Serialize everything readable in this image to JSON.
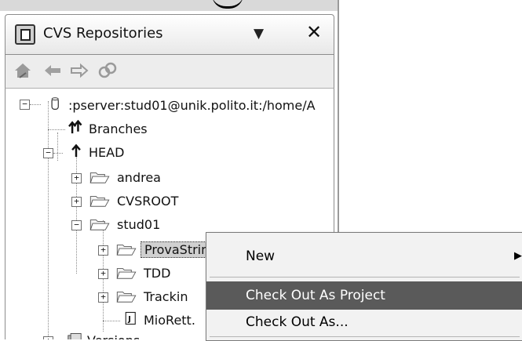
{
  "view": {
    "title": "CVS Repositories",
    "menu_icon": "▼",
    "close_icon": "✕"
  },
  "toolbar": {
    "icons": [
      "home-icon",
      "back-arrow-icon",
      "forward-arrow-icon",
      "link-icon"
    ]
  },
  "tree": {
    "repository": ":pserver:stud01@unik.polito.it:/home/A",
    "branches": "Branches",
    "head": "HEAD",
    "andrea": "andrea",
    "cvsroot": "CVSROOT",
    "stud01": "stud01",
    "provastringhe": "ProvaStringhe",
    "tdd": "TDD",
    "tracking": "Trackin",
    "miorett": "MioRett.",
    "versions": "Versions"
  },
  "context_menu": {
    "new": "New",
    "check_out_as_project": "Check Out As Project",
    "check_out_as": "Check Out As..."
  }
}
